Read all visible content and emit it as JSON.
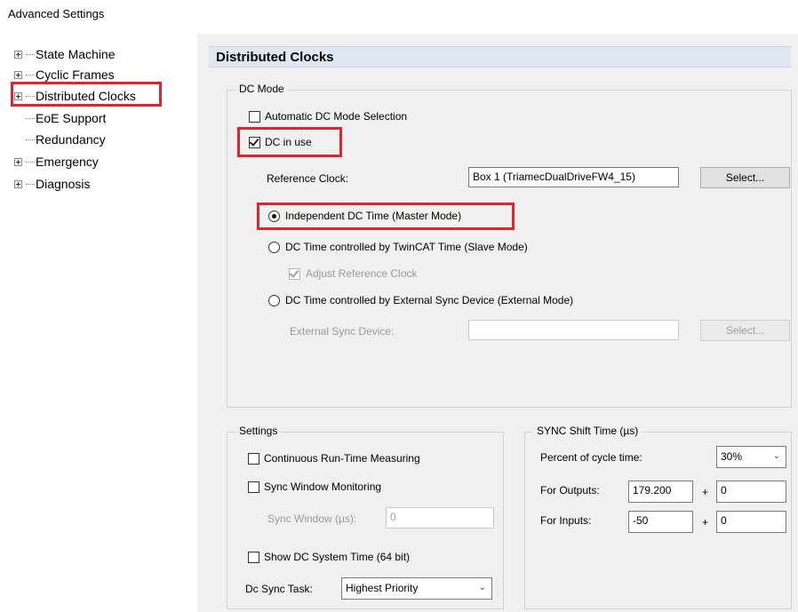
{
  "window": {
    "title": "Advanced Settings"
  },
  "tree": {
    "items": [
      {
        "label": "State Machine",
        "expandable": true
      },
      {
        "label": "Cyclic Frames",
        "expandable": true
      },
      {
        "label": "Distributed Clocks",
        "expandable": true,
        "selected": true
      },
      {
        "label": "EoE Support",
        "expandable": false
      },
      {
        "label": "Redundancy",
        "expandable": false
      },
      {
        "label": "Emergency",
        "expandable": true
      },
      {
        "label": "Diagnosis",
        "expandable": true
      }
    ]
  },
  "header": {
    "title": "Distributed Clocks"
  },
  "dc_mode": {
    "group_title": "DC Mode",
    "auto_dc": {
      "label": "Automatic DC Mode Selection",
      "checked": false
    },
    "dc_in_use": {
      "label": "DC in use",
      "checked": true
    },
    "reference_clock": {
      "label": "Reference Clock:",
      "value": "Box 1 (TriamecDualDriveFW4_15)",
      "button": "Select..."
    },
    "radio_master": {
      "label": "Independent DC Time (Master Mode)",
      "selected": true
    },
    "radio_slave": {
      "label": "DC Time controlled by TwinCAT Time (Slave Mode)",
      "selected": false
    },
    "adjust_ref": {
      "label": "Adjust Reference Clock",
      "checked": true,
      "enabled": false
    },
    "radio_external": {
      "label": "DC Time controlled by External Sync Device (External Mode)",
      "selected": false
    },
    "external_sync": {
      "label": "External Sync Device:",
      "value": "",
      "button": "Select..."
    }
  },
  "settings": {
    "group_title": "Settings",
    "continuous_runtime": {
      "label": "Continuous Run-Time Measuring",
      "checked": false
    },
    "sync_window_monitoring": {
      "label": "Sync Window Monitoring",
      "checked": false
    },
    "sync_window": {
      "label": "Sync Window (µs):",
      "value": "0"
    },
    "show_dc_time": {
      "label": "Show DC System Time (64 bit)",
      "checked": false
    },
    "dc_sync_task": {
      "label": "Dc Sync Task:",
      "value": "Highest Priority"
    }
  },
  "sync_shift": {
    "group_title": "SYNC Shift Time (µs)",
    "percent": {
      "label": "Percent of cycle time:",
      "value": "30%"
    },
    "outputs": {
      "label": "For Outputs:",
      "value": "179.200",
      "plus": "+",
      "offset": "0"
    },
    "inputs": {
      "label": "For Inputs:",
      "value": "-50",
      "plus": "+",
      "offset": "0"
    }
  },
  "colors": {
    "highlight": "#e0242e",
    "header_bg": "#dfe7f0",
    "panel_bg": "#f0f0f0"
  }
}
